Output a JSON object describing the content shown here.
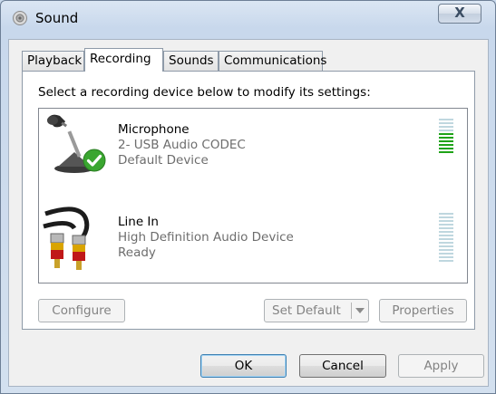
{
  "window": {
    "title": "Sound",
    "close_symbol": "X"
  },
  "tabs": [
    {
      "label": "Playback"
    },
    {
      "label": "Recording"
    },
    {
      "label": "Sounds"
    },
    {
      "label": "Communications"
    }
  ],
  "panel": {
    "instruction": "Select a recording device below to modify its settings:",
    "devices": [
      {
        "name": "Microphone",
        "description": "2- USB Audio CODEC",
        "status": "Default Device",
        "icon": "microphone-icon",
        "level_bars_total": 10,
        "level_bars_active": 6
      },
      {
        "name": "Line In",
        "description": "High Definition Audio Device",
        "status": "Ready",
        "icon": "line-in-cable-icon",
        "level_bars_total": 14,
        "level_bars_active": 0
      }
    ],
    "buttons": {
      "configure": "Configure",
      "set_default": "Set Default",
      "properties": "Properties"
    }
  },
  "dialog_buttons": {
    "ok": "OK",
    "cancel": "Cancel",
    "apply": "Apply"
  },
  "colors": {
    "meter_active": "#1ea317",
    "meter_inactive": "#bfd7df",
    "check_green": "#3aa630"
  }
}
